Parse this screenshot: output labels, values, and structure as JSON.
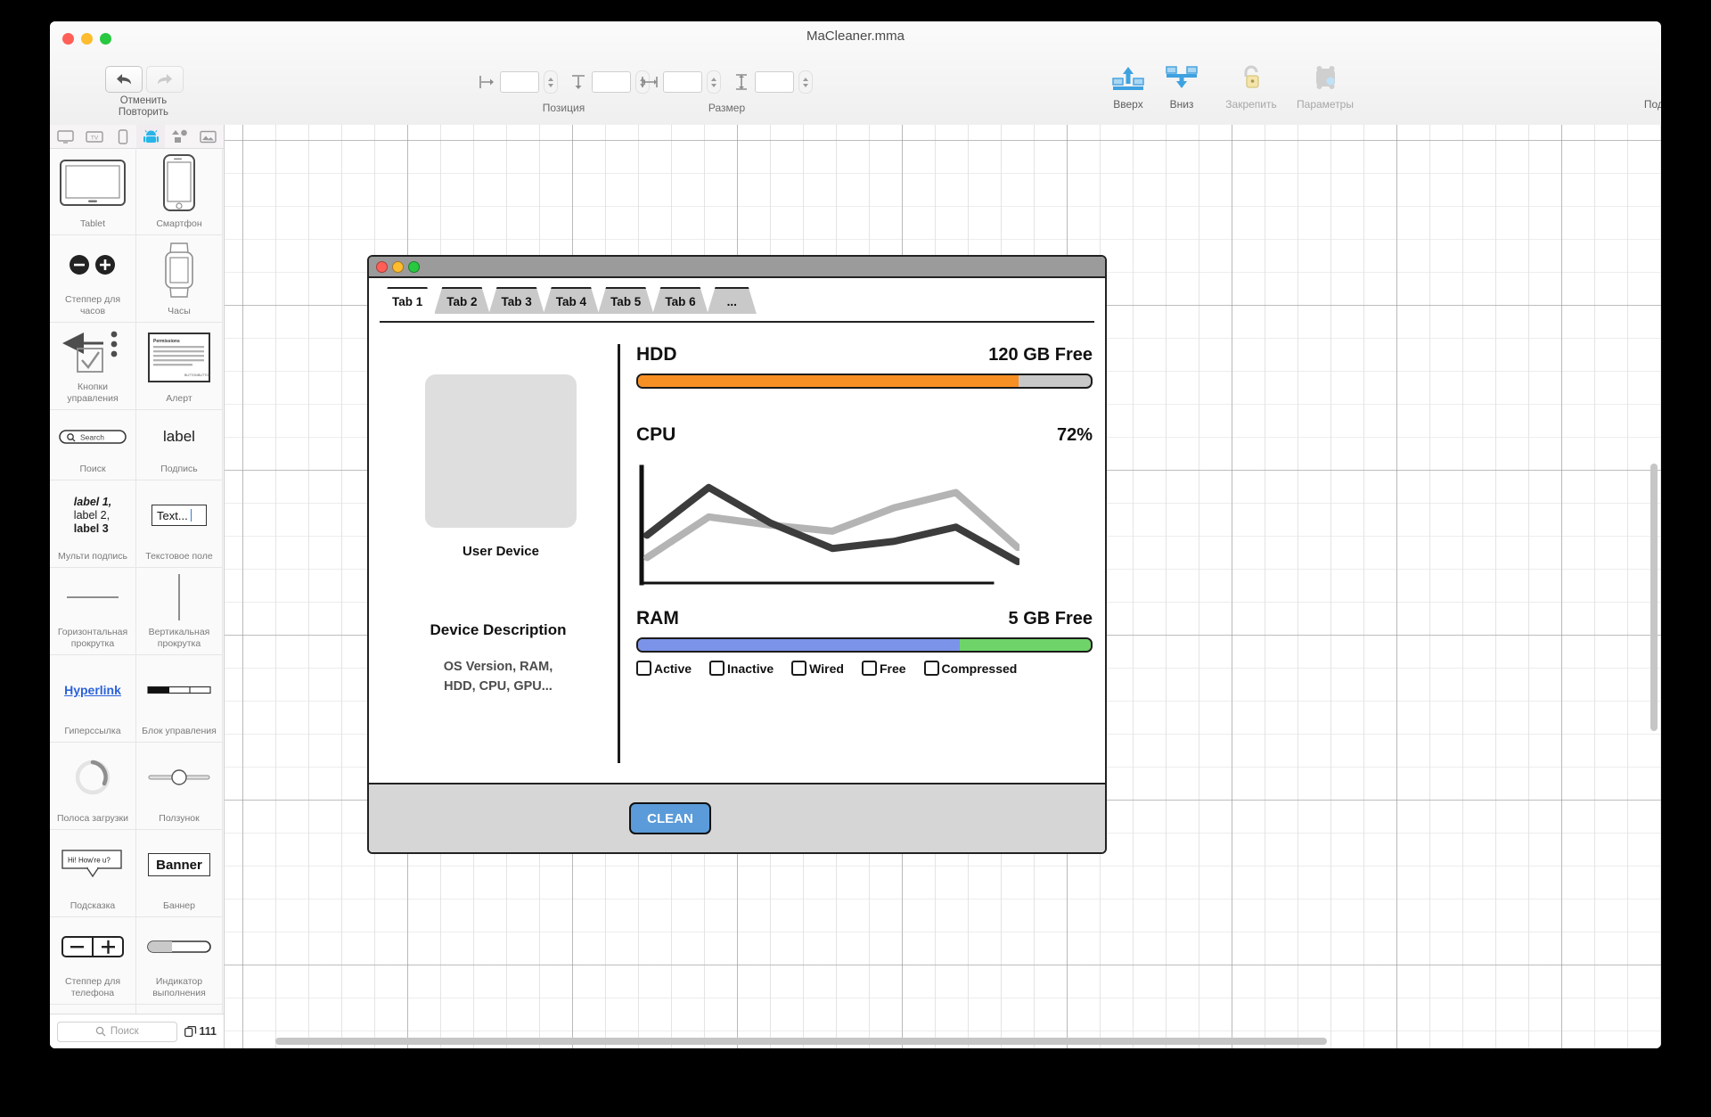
{
  "window": {
    "title": "MaCleaner.mma",
    "traffic_lights": [
      "close",
      "minimize",
      "zoom"
    ]
  },
  "toolbar": {
    "undo_label": "Отменить",
    "redo_label": "Повторить",
    "position_group_label": "Позиция",
    "size_group_label": "Размер",
    "position_x": "",
    "position_y": "",
    "size_w": "",
    "size_h": "",
    "items": [
      {
        "label": "Вверх",
        "icon": "bring-forward-icon",
        "enabled": true
      },
      {
        "label": "Вниз",
        "icon": "send-backward-icon",
        "enabled": true
      },
      {
        "label": "Закрепить",
        "icon": "lock-icon",
        "enabled": false
      },
      {
        "label": "Параметры",
        "icon": "settings-icon",
        "enabled": false
      }
    ],
    "share_label": "Поделиться",
    "share_icon": "share-icon"
  },
  "library": {
    "tabs": [
      {
        "name": "desktop-icon",
        "active": false
      },
      {
        "name": "tv-icon",
        "active": false
      },
      {
        "name": "phone-icon",
        "active": false
      },
      {
        "name": "android-icon",
        "active": true
      },
      {
        "name": "shapes-icon",
        "active": false
      },
      {
        "name": "image-icon",
        "active": false
      }
    ],
    "items": [
      {
        "caption": "Tablet",
        "art": "tablet"
      },
      {
        "caption": "Смартфон",
        "art": "smartphone"
      },
      {
        "caption": "Степпер для часов",
        "art": "watch-stepper"
      },
      {
        "caption": "Часы",
        "art": "watch"
      },
      {
        "caption": "Кнопки управления",
        "art": "control-buttons"
      },
      {
        "caption": "Алерт",
        "art": "alert"
      },
      {
        "caption": "Поиск",
        "art": "search-field"
      },
      {
        "caption": "Подпись",
        "art": "label"
      },
      {
        "caption": "Мульти подпись",
        "art": "multi-label"
      },
      {
        "caption": "Текстовое поле",
        "art": "text-field"
      },
      {
        "caption": "Горизонтальная прокрутка",
        "art": "hscroll"
      },
      {
        "caption": "Вертикальная прокрутка",
        "art": "vscroll"
      },
      {
        "caption": "Гиперссылка",
        "art": "hyperlink"
      },
      {
        "caption": "Блок управления",
        "art": "segmented"
      },
      {
        "caption": "Полоса загрузки",
        "art": "spinner"
      },
      {
        "caption": "Ползунок",
        "art": "slider"
      },
      {
        "caption": "Подсказка",
        "art": "tooltip"
      },
      {
        "caption": "Баннер",
        "art": "banner"
      },
      {
        "caption": "Степпер для телефона",
        "art": "phone-stepper"
      },
      {
        "caption": "Индикатор выполнения",
        "art": "progress"
      }
    ],
    "art_text": {
      "search_field": "Search",
      "label": "label",
      "multi_label_1": "label 1,",
      "multi_label_2": "label 2,",
      "multi_label_3": "label 3",
      "text_field": "Text...",
      "hyperlink": "Hyperlink",
      "tooltip": "Hi! How're u?",
      "banner": "Banner",
      "alert_title": "Permissions",
      "alert_btn_1": "BUTTON",
      "alert_btn_2": "BUTTON",
      "stepper_minus": "–",
      "stepper_plus": "+"
    },
    "search_placeholder": "Поиск",
    "item_count": "111"
  },
  "mockup": {
    "tabs": [
      {
        "label": "Tab 1",
        "active": true
      },
      {
        "label": "Tab 2",
        "active": false
      },
      {
        "label": "Tab 3",
        "active": false
      },
      {
        "label": "Tab 4",
        "active": false
      },
      {
        "label": "Tab 5",
        "active": false
      },
      {
        "label": "Tab 6",
        "active": false
      },
      {
        "label": "...",
        "active": false
      }
    ],
    "device_caption": "User Device",
    "description_title": "Device Description",
    "description_body": "OS Version, RAM,\nHDD, CPU, GPU...",
    "description_line_1": "OS Version, RAM,",
    "description_line_2": "HDD, CPU, GPU...",
    "hdd": {
      "name": "HDD",
      "value": "120 GB Free",
      "used_percent": 84,
      "fill_color": "#f79024",
      "track_color": "#c8c8c8"
    },
    "cpu": {
      "name": "CPU",
      "value": "72%"
    },
    "ram": {
      "name": "RAM",
      "value": "5 GB Free",
      "segments": [
        {
          "name": "used",
          "percent": 71,
          "color": "#7b93e8"
        },
        {
          "name": "free",
          "percent": 29,
          "color": "#6ed46a"
        }
      ]
    },
    "checkboxes": [
      {
        "label": "Active",
        "checked": false
      },
      {
        "label": "Inactive",
        "checked": false
      },
      {
        "label": "Wired",
        "checked": false
      },
      {
        "label": "Free",
        "checked": false
      },
      {
        "label": "Compressed",
        "checked": false
      }
    ],
    "clean_button": "CLEAN"
  },
  "chart_data": {
    "type": "line",
    "title": "CPU",
    "annotation": "72%",
    "xlabel": "",
    "ylabel": "",
    "grid": false,
    "legend": "none",
    "xlim": [
      0,
      6
    ],
    "ylim": [
      0,
      100
    ],
    "x": [
      0,
      1,
      2,
      3,
      4,
      5,
      6
    ],
    "series": [
      {
        "name": "cpu-dark",
        "color": "#3c3c3c",
        "values": [
          40,
          87,
          52,
          27,
          34,
          48,
          14
        ]
      },
      {
        "name": "cpu-light",
        "color": "#b4b4b4",
        "values": [
          18,
          58,
          50,
          44,
          67,
          82,
          28
        ]
      }
    ]
  }
}
